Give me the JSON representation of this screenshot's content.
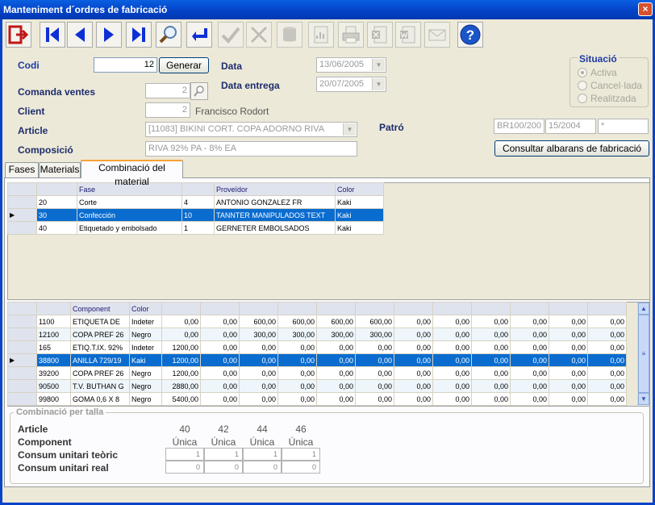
{
  "window": {
    "title": "Manteniment d´ordres de fabricació",
    "close_glyph": "×"
  },
  "toolbar": [
    {
      "name": "exit-button",
      "icon": "exit-icon"
    },
    {
      "name": "first-record-button",
      "icon": "first-icon"
    },
    {
      "name": "previous-record-button",
      "icon": "previous-icon"
    },
    {
      "name": "next-record-button",
      "icon": "next-icon"
    },
    {
      "name": "last-record-button",
      "icon": "last-icon"
    },
    {
      "name": "search-button",
      "icon": "search-icon"
    },
    {
      "name": "enter-button",
      "icon": "enter-icon"
    },
    {
      "name": "accept-button",
      "icon": "check-icon"
    },
    {
      "name": "cancel-button",
      "icon": "cross-icon"
    },
    {
      "name": "database-button",
      "icon": "database-icon"
    },
    {
      "name": "report-button",
      "icon": "report-icon"
    },
    {
      "name": "print-button",
      "icon": "printer-icon"
    },
    {
      "name": "excel-button",
      "icon": "excel-icon"
    },
    {
      "name": "word-button",
      "icon": "word-icon"
    },
    {
      "name": "mail-button",
      "icon": "mail-icon"
    },
    {
      "name": "help-button",
      "icon": "help-icon"
    }
  ],
  "form": {
    "codi_label": "Codi",
    "codi_value": "12",
    "generar_label": "Generar",
    "data_label": "Data",
    "data_value": "13/06/2005",
    "data_entrega_label": "Data entrega",
    "data_entrega_value": "20/07/2005",
    "comanda_label": "Comanda ventes",
    "comanda_value": "2",
    "client_label": "Client",
    "client_code": "2",
    "client_name": "Francisco Rodort",
    "article_label": "Article",
    "article_value": "[11083] BIKINI CORT. COPA ADORNO RIVA",
    "composicio_label": "Composició",
    "composicio_value": "RIVA 92% PA - 8% EA",
    "patro_label": "Patró",
    "patro_1": "BR100/200",
    "patro_2": "15/2004",
    "patro_3": "*",
    "consultar_label": "Consultar albarans de fabricació"
  },
  "situacio": {
    "title": "Situació",
    "options": [
      "Activa",
      "Cancel·lada",
      "Realitzada"
    ],
    "selected": "Activa"
  },
  "tabs": [
    "Fases",
    "Materials",
    "Combinació del material"
  ],
  "active_tab": "Combinació del material",
  "phases": {
    "columns": [
      "Fase",
      "",
      "Proveïdor",
      "Color"
    ],
    "rows": [
      {
        "code": "20",
        "fase": "Corte",
        "n": "4",
        "proveidor": "ANTONIO GONZALEZ FR",
        "color": "Kaki"
      },
      {
        "code": "30",
        "fase": "Confección",
        "n": "10",
        "proveidor": "TANNTER MANIPULADOS TEXT",
        "color": "Kaki"
      },
      {
        "code": "40",
        "fase": "Etiquetado y embolsado",
        "n": "1",
        "proveidor": "GERNETER EMBOLSADOS",
        "color": "Kaki"
      }
    ],
    "selected_index": 1
  },
  "components": {
    "columns": [
      "Component",
      "Color"
    ],
    "rows": [
      {
        "code": "1100",
        "name": "ETIQUETA DE",
        "color": "Indeter",
        "values": [
          "0,00",
          "0,00",
          "600,00",
          "600,00",
          "600,00",
          "600,00",
          "0,00",
          "0,00",
          "0,00",
          "0,00",
          "0,00",
          "0,00"
        ]
      },
      {
        "code": "12100",
        "name": "COPA PREF 26",
        "color": "Negro",
        "values": [
          "0,00",
          "0,00",
          "300,00",
          "300,00",
          "300,00",
          "300,00",
          "0,00",
          "0,00",
          "0,00",
          "0,00",
          "0,00",
          "0,00"
        ]
      },
      {
        "code": "165",
        "name": "ETIQ.T.IX. 92%",
        "color": "Indeter",
        "values": [
          "1200,00",
          "0,00",
          "0,00",
          "0,00",
          "0,00",
          "0,00",
          "0,00",
          "0,00",
          "0,00",
          "0,00",
          "0,00",
          "0,00"
        ]
      },
      {
        "code": "38800",
        "name": "ANILLA 729/19",
        "color": "Kaki",
        "values": [
          "1200,00",
          "0,00",
          "0,00",
          "0,00",
          "0,00",
          "0,00",
          "0,00",
          "0,00",
          "0,00",
          "0,00",
          "0,00",
          "0,00"
        ]
      },
      {
        "code": "39200",
        "name": "COPA PREF 26",
        "color": "Negro",
        "values": [
          "1200,00",
          "0,00",
          "0,00",
          "0,00",
          "0,00",
          "0,00",
          "0,00",
          "0,00",
          "0,00",
          "0,00",
          "0,00",
          "0,00"
        ]
      },
      {
        "code": "90500",
        "name": "T.V. BUTHAN G",
        "color": "Negro",
        "values": [
          "2880,00",
          "0,00",
          "0,00",
          "0,00",
          "0,00",
          "0,00",
          "0,00",
          "0,00",
          "0,00",
          "0,00",
          "0,00",
          "0,00"
        ]
      },
      {
        "code": "99800",
        "name": "GOMA 0,6 X 8",
        "color": "Negro",
        "values": [
          "5400,00",
          "0,00",
          "0,00",
          "0,00",
          "0,00",
          "0,00",
          "0,00",
          "0,00",
          "0,00",
          "0,00",
          "0,00",
          "0,00"
        ]
      }
    ],
    "selected_index": 3
  },
  "talla": {
    "title": "Combinació per talla",
    "article_label": "Article",
    "component_label": "Component",
    "teoric_label": "Consum unitari teòric",
    "real_label": "Consum unitari real",
    "sizes": [
      "40",
      "42",
      "44",
      "46"
    ],
    "components": [
      "Única",
      "Única",
      "Única",
      "Única"
    ],
    "teoric": [
      "1",
      "1",
      "1",
      "1"
    ],
    "real": [
      "0",
      "0",
      "0",
      "0"
    ]
  }
}
